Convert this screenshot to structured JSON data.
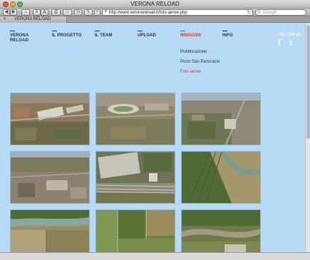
{
  "window": {
    "title": "VERONA RELOAD"
  },
  "toolbar": {
    "back_glyph": "◀",
    "forward_glyph": "▶",
    "home_glyph": "⌂",
    "font_small": "A",
    "font_large": "A",
    "print_glyph": "⎙",
    "book_glyph": "▭",
    "history_glyph": "◷",
    "bookmark_glyph": "✎",
    "add_glyph": "+",
    "url": "http://www.veronareload.it/foto-aeree.php",
    "search_placeholder": "Google"
  },
  "tab": {
    "label": "VERONA RELOAD",
    "close_glyph": "✕"
  },
  "nav": {
    "brand_line1": "VERONA",
    "brand_line2": "RELOAD",
    "progetto": "IL PROGETTO",
    "team": "IL TEAM",
    "upload": "UPLOAD",
    "immagini": "IMMAGINI",
    "info": "INFO"
  },
  "submenu": {
    "item1": "Pubblicazione",
    "item2": "Porto San Pancrazio",
    "item3": "Foto aeree"
  },
  "social": {
    "follow_label": "FOLLOW US",
    "facebook_glyph": "f",
    "twitter_glyph": "t"
  },
  "colors": {
    "page_bg": "#b8dbf5",
    "accent": "#e53221",
    "nav_text": "#1c2e44"
  },
  "photos": [
    {
      "kind": "industrial-aerial"
    },
    {
      "kind": "stadium-aerial"
    },
    {
      "kind": "city-rail-aerial"
    },
    {
      "kind": "urban-dense-aerial"
    },
    {
      "kind": "warehouse-rail-aerial"
    },
    {
      "kind": "fields-river-aerial"
    },
    {
      "kind": "river-fields-aerial"
    },
    {
      "kind": "farmland-aerial"
    },
    {
      "kind": "river-bend-aerial"
    }
  ]
}
